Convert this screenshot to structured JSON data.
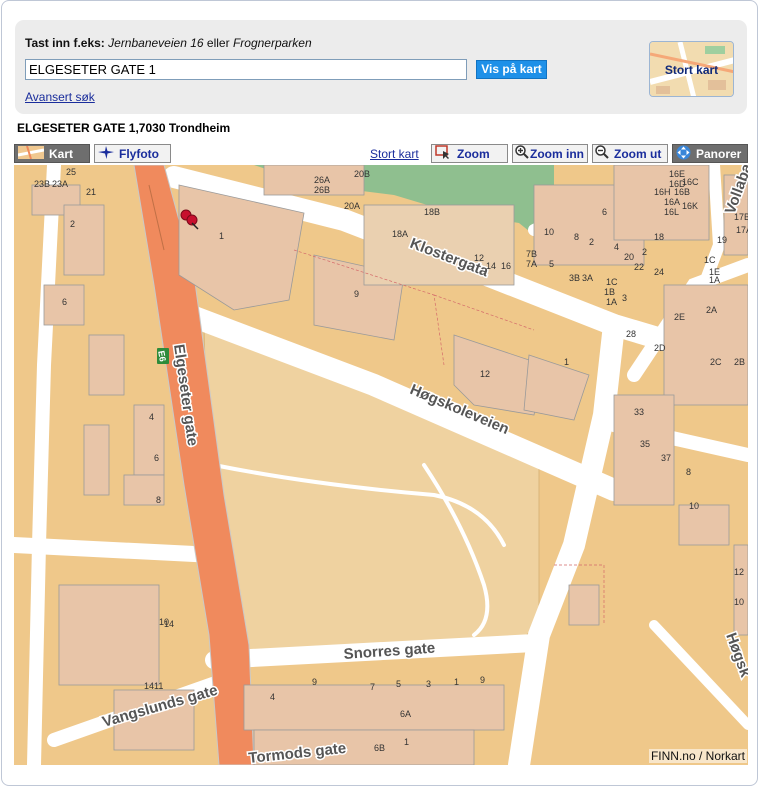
{
  "search": {
    "hint_bold": "Tast inn f.eks:",
    "hint_example1": "Jernbaneveien 16",
    "hint_or": "eller",
    "hint_example2": "Frognerparken",
    "input_value": "ELGESETER GATE 1",
    "button_label": "Vis på kart",
    "advanced_link": "Avansert søk",
    "big_map_label": "Stort kart"
  },
  "result": {
    "address": "ELGESETER GATE 1,7030 Trondheim"
  },
  "toolbar": {
    "kart": "Kart",
    "flyfoto": "Flyfoto",
    "stort_kart": "Stort kart",
    "zoom": "Zoom",
    "zoom_inn": "Zoom inn",
    "zoom_ut": "Zoom ut",
    "panorer": "Panorer"
  },
  "map": {
    "copyright": "FINN.no / Norkart",
    "road_shield": "E6",
    "streets": {
      "elgeseter": "Elgeseter gate",
      "klostergata": "Klostergata",
      "hogskoleveien": "Høgskoleveien",
      "snorres": "Snorres gate",
      "vangslunds": "Vangslunds gate",
      "tormods": "Tormods gate",
      "vollabakken": "Vollaba",
      "hogskole_right": "Høgsk"
    },
    "house_numbers": [
      "23B",
      "23A",
      "25",
      "21",
      "2",
      "6",
      "4",
      "6",
      "8",
      "10",
      "14",
      "26A",
      "26B",
      "20B",
      "20A",
      "18B",
      "18A",
      "1",
      "9",
      "12",
      "1",
      "16",
      "14",
      "12",
      "10",
      "8",
      "7B",
      "7A",
      "5",
      "3B",
      "3A",
      "1C",
      "1B",
      "1A",
      "3",
      "28",
      "6",
      "2",
      "24",
      "22",
      "20",
      "4",
      "2",
      "18",
      "16E",
      "16D",
      "16C",
      "16B",
      "16A",
      "16K",
      "16L",
      "16H",
      "17B",
      "17A",
      "19",
      "1C",
      "1E",
      "1A",
      "2E",
      "2D",
      "2A",
      "2C",
      "2B",
      "33",
      "35",
      "37",
      "8",
      "10",
      "12",
      "10",
      "14",
      "11",
      "9",
      "7",
      "5",
      "3",
      "1",
      "9",
      "4",
      "6A",
      "6B",
      "1"
    ],
    "colors": {
      "block": "#efc88a",
      "building": "#e8c5a8",
      "road": "#ffffff",
      "highway": "#f08a5d",
      "park": "#8fbf8f",
      "open_area": "#efd2a0",
      "line": "#9a9a9a"
    }
  }
}
